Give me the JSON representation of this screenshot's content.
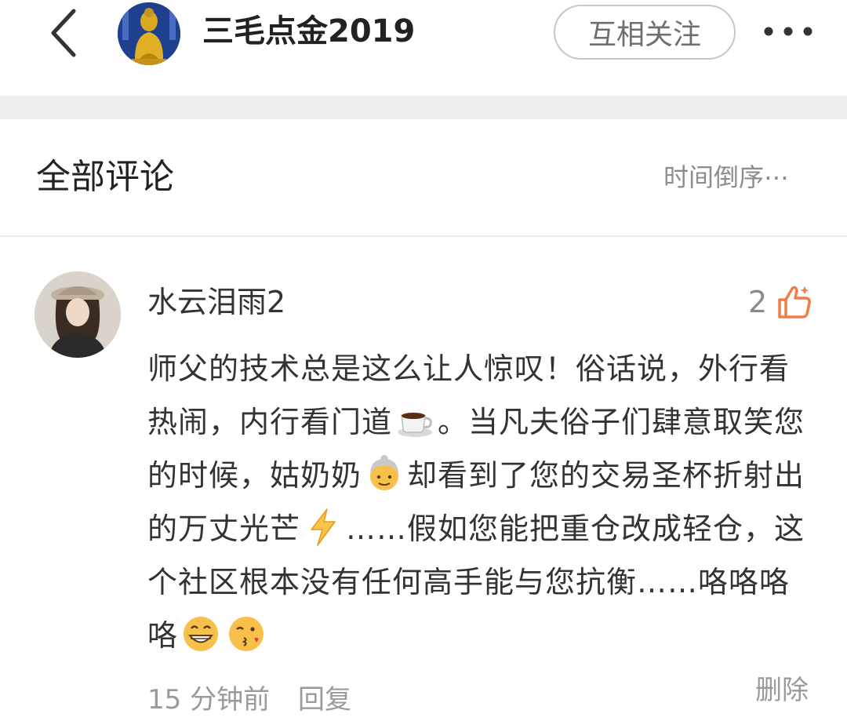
{
  "header": {
    "title": "三毛点金2019",
    "follow_label": "互相关注",
    "back_icon": "chevron-left-icon",
    "more_icon": "more-dots-icon"
  },
  "section": {
    "title": "全部评论",
    "sort_label": "时间倒序⋯"
  },
  "comment": {
    "username": "水云泪雨2",
    "likes": "2",
    "segments": [
      "师父的技术总是这么让人惊叹！俗话说，外行看热闹，内行看门道",
      "。当凡夫俗子们肆意取笑您的时候，姑奶奶",
      "却看到了您的交易圣杯折射出的万丈光芒",
      "……假如您能把重仓改成轻仓，这个社区根本没有任何高手能与您抗衡……咯咯咯咯"
    ],
    "emojis": [
      "coffee-emoji",
      "old-woman-emoji",
      "lightning-emoji",
      "grinning-emoji",
      "kissing-wink-emoji"
    ],
    "time": "15 分钟前",
    "reply_label": "回复",
    "delete_label": "删除"
  },
  "colors": {
    "like_accent": "#f07d47",
    "band": "#eeeeee",
    "muted_text": "#9a9a9a"
  }
}
